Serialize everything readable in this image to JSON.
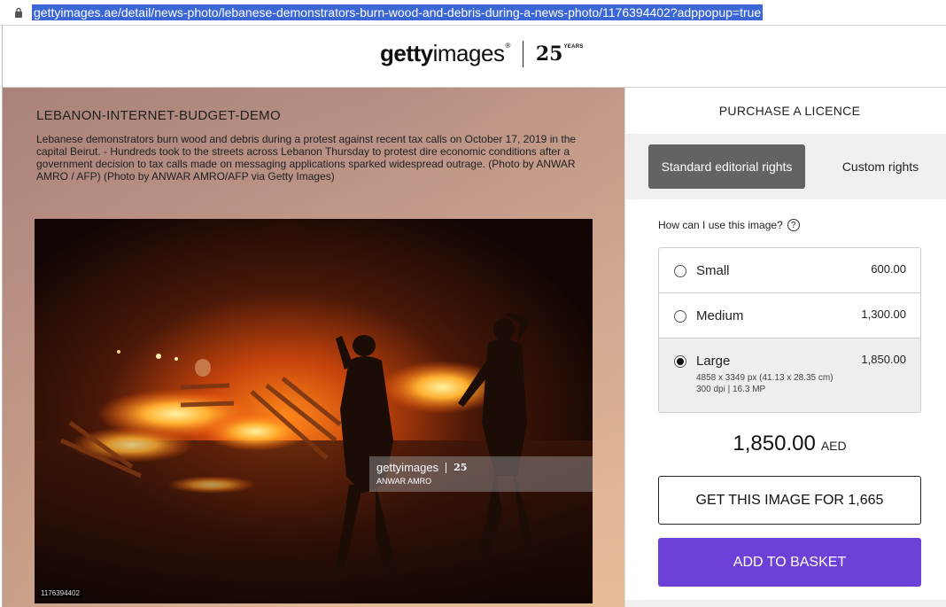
{
  "browser": {
    "url": "gettyimages.ae/detail/news-photo/lebanese-demonstrators-burn-wood-and-debris-during-a-news-photo/1176394402?adppopup=true"
  },
  "header": {
    "logo_bold": "getty",
    "logo_light": "images",
    "logo_reg": "®",
    "anniversary_number": "25",
    "anniversary_word": "YEARS"
  },
  "image": {
    "title": "LEBANON-INTERNET-BUDGET-DEMO",
    "caption": "Lebanese demonstrators burn wood and debris during a protest against recent tax calls on October 17, 2019 in the capital Beirut. - Hundreds took to the streets across Lebanon Thursday to protest dire economic conditions after a government decision to tax calls made on messaging applications sparked widespread outrage. (Photo by ANWAR AMRO / AFP) (Photo by ANWAR AMRO/AFP via Getty Images)",
    "watermark_logo": "gettyimages",
    "watermark_25": "25",
    "watermark_credit": "ANWAR AMRO",
    "photo_id": "1176394402"
  },
  "purchase": {
    "title": "PURCHASE A LICENCE",
    "rights_standard": "Standard editorial rights",
    "rights_custom": "Custom rights",
    "how_use": "How can I use this image?",
    "help_symbol": "?",
    "sizes": [
      {
        "name": "Small",
        "price": "600.00",
        "selected": false,
        "details1": "",
        "details2": ""
      },
      {
        "name": "Medium",
        "price": "1,300.00",
        "selected": false,
        "details1": "",
        "details2": ""
      },
      {
        "name": "Large",
        "price": "1,850.00",
        "selected": true,
        "details1": "4858 x 3349 px (41.13 x 28.35 cm)",
        "details2": "300 dpi | 16.3 MP"
      }
    ],
    "total_amount": "1,850.00",
    "total_currency": "AED",
    "get_button": "GET THIS IMAGE FOR 1,665",
    "basket_button": "ADD TO BASKET"
  },
  "colors": {
    "accent": "#6d41d8",
    "selected_tab": "#636363",
    "url_highlight": "#3b66d6"
  }
}
